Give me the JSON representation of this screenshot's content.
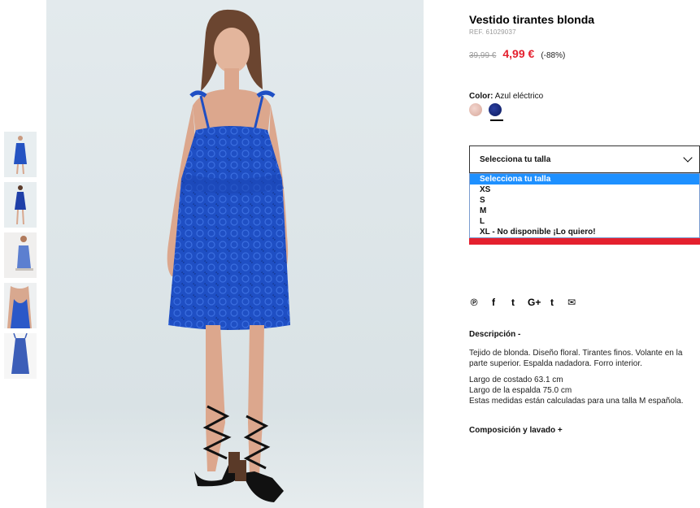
{
  "product": {
    "title": "Vestido tirantes blonda",
    "ref": "REF. 61029037",
    "old_price": "39,99 €",
    "new_price": "4,99 €",
    "discount": "(-88%)"
  },
  "color": {
    "label": "Color:",
    "value": "Azul eléctrico",
    "swatches": [
      "#e2b7ac",
      "#13246e"
    ]
  },
  "size": {
    "select_label": "Selecciona tu talla",
    "options": [
      "Selecciona tu talla",
      "XS",
      "S",
      "M",
      "L",
      "XL - No disponible ¡Lo quiero!"
    ]
  },
  "social": {
    "icons": [
      "pinterest-icon",
      "facebook-icon",
      "twitter-icon",
      "google-plus-icon",
      "tumblr-icon",
      "email-icon"
    ],
    "glyphs": [
      "℗",
      "f",
      "t",
      "G+",
      "t",
      "✉"
    ]
  },
  "description": {
    "title": "Descripción -",
    "text": "Tejido de blonda. Diseño floral. Tirantes finos. Volante en la parte superior. Espalda nadadora. Forro interior.",
    "measures": [
      "Largo de costado 63.1 cm",
      "Largo de la espalda 75.0 cm",
      "Estas medidas están calculadas para una talla M española."
    ]
  },
  "composition": {
    "title": "Composición y lavado +"
  },
  "colors": {
    "accent_red": "#e4202e",
    "select_blue": "#1e90ff",
    "dress_blue": "#1f4fc4"
  }
}
